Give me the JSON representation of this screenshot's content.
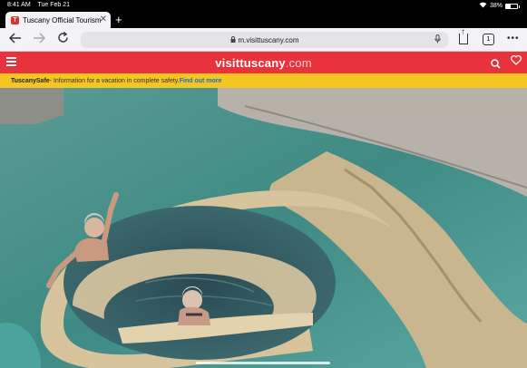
{
  "status_bar": {
    "time": "8:41 AM",
    "date": "Tue Feb 21",
    "battery": "38%",
    "battery_level": 0.38
  },
  "tab": {
    "favicon": "T",
    "title": "Tuscany Official Tourism"
  },
  "toolbar": {
    "url": "m.visittuscany.com",
    "tabs_count": "1"
  },
  "site": {
    "logo_main": "visittuscany",
    "logo_suffix": ".com"
  },
  "banner": {
    "label": "TuscanySafe",
    "text": " - Information for a vacation in complete safety. ",
    "link": "Find out more"
  },
  "colors": {
    "brand_red": "#e8323c",
    "banner_yellow": "#f5c523",
    "link_blue": "#1a6fc8"
  },
  "icons": {
    "back": "chevron-left-icon",
    "forward": "chevron-right-icon",
    "reload": "reload-icon",
    "lock": "lock-icon",
    "mic": "microphone-icon",
    "share": "share-icon",
    "tabs": "tabs-icon",
    "more": "more-icon",
    "menu": "hamburger-icon",
    "search": "search-icon",
    "heart": "heart-icon"
  }
}
